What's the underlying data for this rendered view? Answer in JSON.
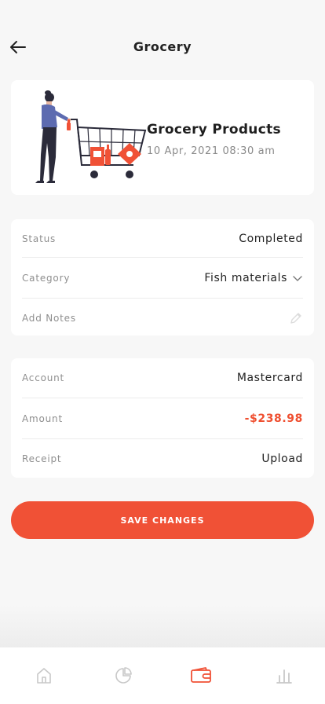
{
  "header": {
    "title": "Grocery",
    "back_icon": "arrow-left-icon"
  },
  "hero": {
    "title": "Grocery Products",
    "date": "10 Apr, 2021 08:30 am",
    "illustration": "woman-with-shopping-cart-illustration"
  },
  "details": [
    {
      "label": "Status",
      "value": "Completed"
    },
    {
      "label": "Category",
      "value": "Fish materials",
      "icon": "chevron-down-icon"
    },
    {
      "label": "Add Notes",
      "value": "",
      "icon": "pencil-icon"
    }
  ],
  "payment": [
    {
      "label": "Account",
      "value": "Mastercard"
    },
    {
      "label": "Amount",
      "value": "-$238.98"
    },
    {
      "label": "Receipt",
      "value": "Upload"
    }
  ],
  "save_button": {
    "label": "SAVE CHANGES"
  },
  "tabbar": {
    "items": [
      {
        "name": "home",
        "icon": "home-icon",
        "active": false
      },
      {
        "name": "stats",
        "icon": "pie-chart-icon",
        "active": false
      },
      {
        "name": "wallet",
        "icon": "wallet-icon",
        "active": true
      },
      {
        "name": "reports",
        "icon": "bar-chart-icon",
        "active": false
      }
    ]
  },
  "colors": {
    "accent": "#f05136",
    "amount": "#ef4f30",
    "label": "#8f8f8f",
    "background": "#f7f7f7"
  }
}
